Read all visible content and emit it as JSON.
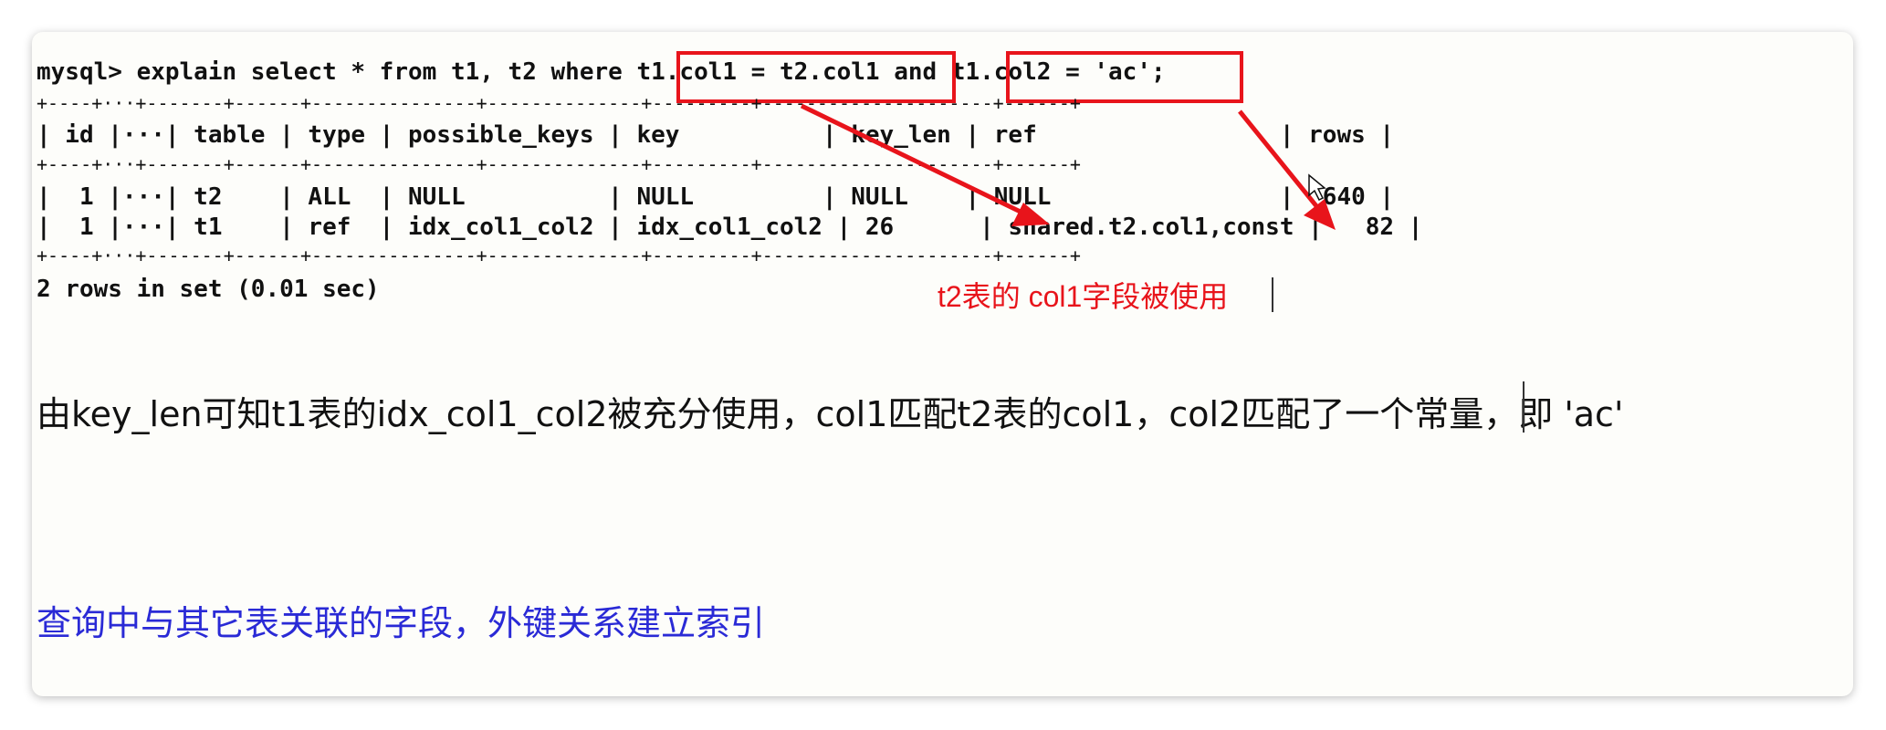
{
  "terminal": {
    "query_prefix": "mysql> explain select * from t1, t2 where ",
    "cond1": "t1.col1 = t2.col1",
    "and_kw": " and ",
    "cond2": "t1.col2 = 'ac';",
    "sep_line": "+----+···+-------+------+---------------+--------------+---------+---------------------+------+",
    "header_line": "| id |···| table | type | possible_keys | key          | key_len | ref                 | rows |",
    "row1": "|  1 |···| t2    | ALL  | NULL          | NULL         | NULL    | NULL                |  640 |",
    "row2": "|  1 |···| t1    | ref  | idx_col1_col2 | idx_col1_col2 | 26      | shared.t2.col1,const |   82 |",
    "footer": "2 rows in set (0.01 sec)"
  },
  "annotations": {
    "red_note": "t2表的 col1字段被使用",
    "explanation": "由key_len可知t1表的idx_col1_col2被充分使用，col1匹配t2表的col1，col2匹配了一个常量，即 'ac'",
    "blue_note": "查询中与其它表关联的字段，外键关系建立索引"
  },
  "colors": {
    "highlight_red": "#e8141b",
    "note_blue": "#2a2ad6"
  }
}
